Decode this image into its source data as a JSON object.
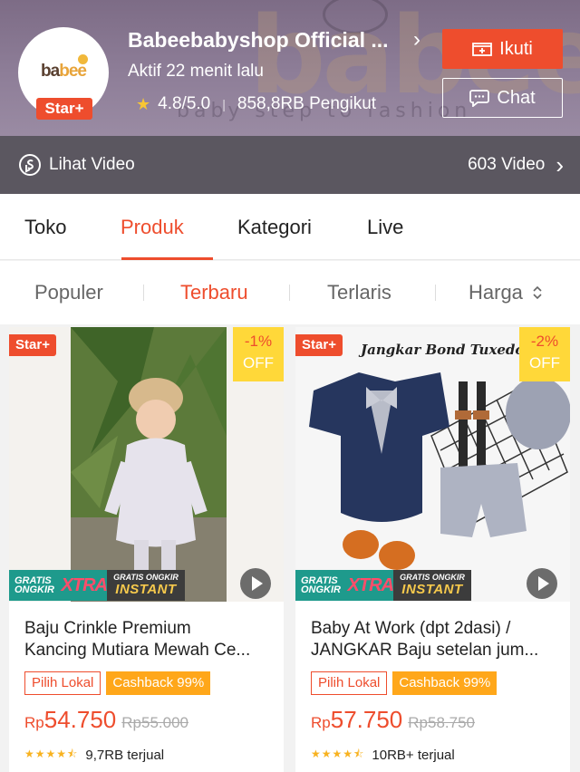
{
  "shop": {
    "logo_text_a": "ba",
    "logo_text_b": "bee",
    "star_badge": "Star+",
    "name": "Babeebabyshop Official ...",
    "active": "Aktif 22 menit lalu",
    "rating": "4.8/5.0",
    "followers": "858,8RB Pengikut",
    "banner_word": "babee",
    "banner_tagline": "baby step to fashion",
    "follow_label": "Ikuti",
    "chat_label": "Chat"
  },
  "video_bar": {
    "left_label": "Lihat Video",
    "right_label": "603 Video"
  },
  "tabs": [
    {
      "label": "Toko"
    },
    {
      "label": "Produk"
    },
    {
      "label": "Kategori"
    },
    {
      "label": "Live"
    }
  ],
  "active_tab": "Produk",
  "sort": [
    {
      "label": "Populer"
    },
    {
      "label": "Terbaru"
    },
    {
      "label": "Terlaris"
    },
    {
      "label": "Harga"
    }
  ],
  "active_sort": "Terbaru",
  "products": [
    {
      "star_badge": "Star+",
      "discount": "-1%",
      "off": "OFF",
      "ongkir_small": "GRATIS ONGKIR",
      "xtra": "XTRA",
      "instant_small": "GRATIS ONGKIR",
      "instant": "INSTANT",
      "title_line1": "Baju Crinkle Premium",
      "title_line2": "Kancing Mutiara Mewah Ce...",
      "badge_lokal": "Pilih Lokal",
      "badge_cashback": "Cashback 99%",
      "currency": "Rp",
      "price": "54.750",
      "old_price": "Rp55.000",
      "sold": "9,7RB terjual",
      "rating_stars": 4.5
    },
    {
      "star_badge": "Star+",
      "discount": "-2%",
      "off": "OFF",
      "image_caption": "Jangkar Bond Tuxedo",
      "ongkir_small": "GRATIS ONGKIR",
      "xtra": "XTRA",
      "instant_small": "GRATIS ONGKIR",
      "instant": "INSTANT",
      "title_line1": "Baby At Work (dpt 2dasi) /",
      "title_line2": "JANGKAR Baju setelan jum...",
      "badge_lokal": "Pilih Lokal",
      "badge_cashback": "Cashback 99%",
      "currency": "Rp",
      "price": "57.750",
      "old_price": "Rp58.750",
      "sold": "10RB+ terjual",
      "rating_stars": 4.5
    }
  ],
  "colors": {
    "accent": "#ee4d2d",
    "header_bg": "#8e7e98",
    "video_bar_bg": "#5b5760",
    "cashback": "#ffa71a",
    "discount_bg": "#ffd839"
  }
}
